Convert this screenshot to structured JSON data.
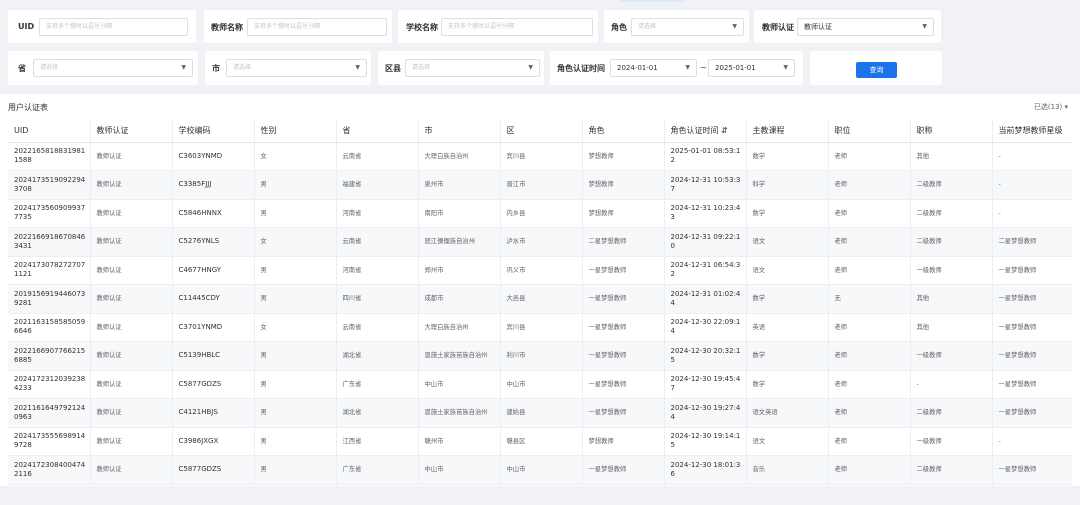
{
  "filters": {
    "uid": {
      "label": "UID",
      "placeholder": "支持多个搜时以逗号分隔"
    },
    "teacher_name": {
      "label": "教师名称",
      "placeholder": "支持多个搜时以逗号分隔"
    },
    "school_name": {
      "label": "学校名称",
      "placeholder": "支持多个搜时以逗号分隔"
    },
    "role": {
      "label": "角色",
      "placeholder": "请选择"
    },
    "teacher_cert": {
      "label": "教师认证",
      "value": "教师认证"
    },
    "province": {
      "label": "省",
      "placeholder": "请选择"
    },
    "city": {
      "label": "市",
      "placeholder": "请选择"
    },
    "district": {
      "label": "区县",
      "placeholder": "请选择"
    },
    "role_cert_time": {
      "label": "角色认证时间",
      "start": "2024-01-01",
      "separator": "~",
      "end": "2025-01-01"
    },
    "query_button": "查询"
  },
  "table": {
    "title": "用户认证表",
    "selected_cols": "已选(13) ▾",
    "columns": [
      "UID",
      "教师认证",
      "学校编码",
      "性别",
      "省",
      "市",
      "区",
      "角色",
      "角色认证时间 ⇵",
      "主教课程",
      "职位",
      "职称",
      "当前梦想教师星级"
    ],
    "rows": [
      [
        "20221658188319811588",
        "教师认证",
        "C3603YNMD",
        "女",
        "云南省",
        "大理白族自治州",
        "宾川县",
        "梦想教师",
        "2025-01-01 08:53:12",
        "数学",
        "老师",
        "其他",
        "-"
      ],
      [
        "20241735190922943708",
        "教师认证",
        "C3385FJJJ",
        "男",
        "福建省",
        "泉州市",
        "晋江市",
        "梦想教师",
        "2024-12-31 10:53:37",
        "科学",
        "老师",
        "二级教师",
        "-"
      ],
      [
        "20241735609099377735",
        "教师认证",
        "C5846HNNX",
        "男",
        "河南省",
        "南阳市",
        "内乡县",
        "梦想教师",
        "2024-12-31 10:23:43",
        "数学",
        "老师",
        "二级教师",
        "-"
      ],
      [
        "20221669186708463431",
        "教师认证",
        "C5276YNLS",
        "女",
        "云南省",
        "怒江傈僳族自治州",
        "泸水市",
        "二星梦想教师",
        "2024-12-31 09:22:10",
        "语文",
        "老师",
        "二级教师",
        "二星梦想教师"
      ],
      [
        "20241730782727071121",
        "教师认证",
        "C4677HNGY",
        "男",
        "河南省",
        "郑州市",
        "巩义市",
        "一星梦想教师",
        "2024-12-31 06:54:32",
        "语文",
        "老师",
        "一级教师",
        "一星梦想教师"
      ],
      [
        "20191569194460739281",
        "教师认证",
        "C11445CDY",
        "男",
        "四川省",
        "成都市",
        "大邑县",
        "一星梦想教师",
        "2024-12-31 01:02:44",
        "数学",
        "无",
        "其他",
        "一星梦想教师"
      ],
      [
        "20211631585850596646",
        "教师认证",
        "C3701YNMD",
        "女",
        "云南省",
        "大理白族自治州",
        "宾川县",
        "一星梦想教师",
        "2024-12-30 22:09:14",
        "英语",
        "老师",
        "其他",
        "一星梦想教师"
      ],
      [
        "20221669077662156885",
        "教师认证",
        "C5139HBLC",
        "男",
        "湖北省",
        "恩施土家族苗族自治州",
        "利川市",
        "一星梦想教师",
        "2024-12-30 20:32:15",
        "数学",
        "老师",
        "一级教师",
        "一星梦想教师"
      ],
      [
        "20241723120392384233",
        "教师认证",
        "C5877GDZS",
        "男",
        "广东省",
        "中山市",
        "中山市",
        "一星梦想教师",
        "2024-12-30 19:45:47",
        "数学",
        "老师",
        "-",
        "一星梦想教师"
      ],
      [
        "20211616497921240963",
        "教师认证",
        "C4121HBJS",
        "男",
        "湖北省",
        "恩施土家族苗族自治州",
        "建始县",
        "一星梦想教师",
        "2024-12-30 19:27:44",
        "语文英语",
        "老师",
        "二级教师",
        "一星梦想教师"
      ],
      [
        "20241735556989149728",
        "教师认证",
        "C3986JXGX",
        "男",
        "江西省",
        "赣州市",
        "赣县区",
        "梦想教师",
        "2024-12-30 19:14:15",
        "语文",
        "老师",
        "一级教师",
        "-"
      ],
      [
        "20241723084004742116",
        "教师认证",
        "C5877GDZS",
        "男",
        "广东省",
        "中山市",
        "中山市",
        "一星梦想教师",
        "2024-12-30 18:01:36",
        "音乐",
        "老师",
        "二级教师",
        "一星梦想教师"
      ]
    ]
  },
  "colors": {
    "primary": "#1a73e8",
    "background": "#f0f2f5"
  }
}
